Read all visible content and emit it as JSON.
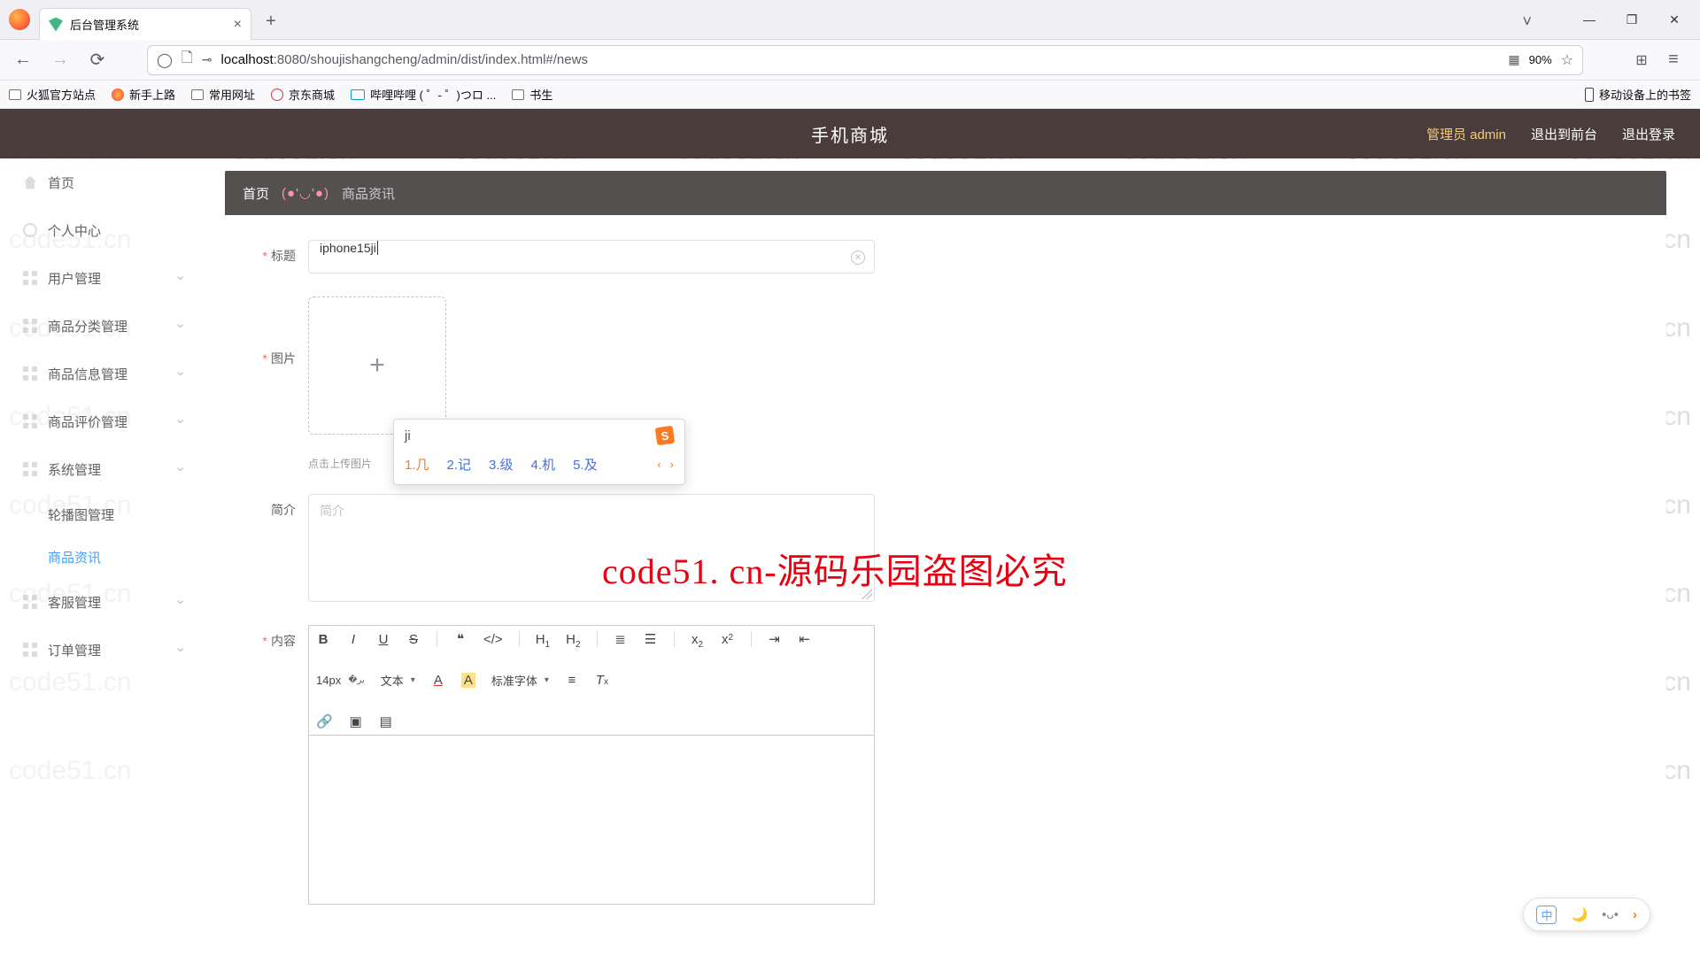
{
  "watermark_text": "code51.cn",
  "big_red_text": "code51. cn-源码乐园盗图必究",
  "browser": {
    "tab_title": "后台管理系统",
    "url_host": "localhost",
    "url_rest": ":8080/shoujishangcheng/admin/dist/index.html#/news",
    "zoom": "90%",
    "bookmarks": [
      {
        "label": "火狐官方站点"
      },
      {
        "label": "新手上路"
      },
      {
        "label": "常用网址"
      },
      {
        "label": "京东商城"
      },
      {
        "label": "哔哩哔哩 ( ゜- ゜)つロ ..."
      },
      {
        "label": "书生"
      }
    ],
    "mobile_bm": "移动设备上的书签"
  },
  "topbar": {
    "title": "手机商城",
    "admin": "管理员 admin",
    "front": "退出到前台",
    "logout": "退出登录"
  },
  "sidebar": {
    "items": [
      {
        "label": "首页",
        "icon": "house"
      },
      {
        "label": "个人中心",
        "icon": "user"
      },
      {
        "label": "用户管理",
        "icon": "grid",
        "children": true
      },
      {
        "label": "商品分类管理",
        "icon": "grid",
        "children": true
      },
      {
        "label": "商品信息管理",
        "icon": "grid",
        "children": true
      },
      {
        "label": "商品评价管理",
        "icon": "grid",
        "children": true
      },
      {
        "label": "系统管理",
        "icon": "grid",
        "children": true
      },
      {
        "label": "轮播图管理",
        "sub": true
      },
      {
        "label": "商品资讯",
        "sub": true,
        "active": true
      },
      {
        "label": "客服管理",
        "icon": "grid",
        "children": true
      },
      {
        "label": "订单管理",
        "icon": "grid",
        "children": true
      }
    ]
  },
  "breadcrumb": {
    "home": "首页",
    "emoji": "(●'◡'●)",
    "current": "商品资讯"
  },
  "form": {
    "title_label": "标题",
    "title_value": "iphone15ji",
    "image_label": "图片",
    "upload_hint": "点击上传图片",
    "intro_label": "简介",
    "intro_placeholder": "简介",
    "content_label": "内容",
    "editor": {
      "size": "14px",
      "block": "文本",
      "font": "标准字体",
      "h1": "H₁",
      "h2": "H₂"
    }
  },
  "ime": {
    "pinyin": "ji",
    "candidates": [
      "1.几",
      "2.记",
      "3.级",
      "4.机",
      "5.及"
    ]
  },
  "ime_bar": {
    "mode": "中"
  }
}
